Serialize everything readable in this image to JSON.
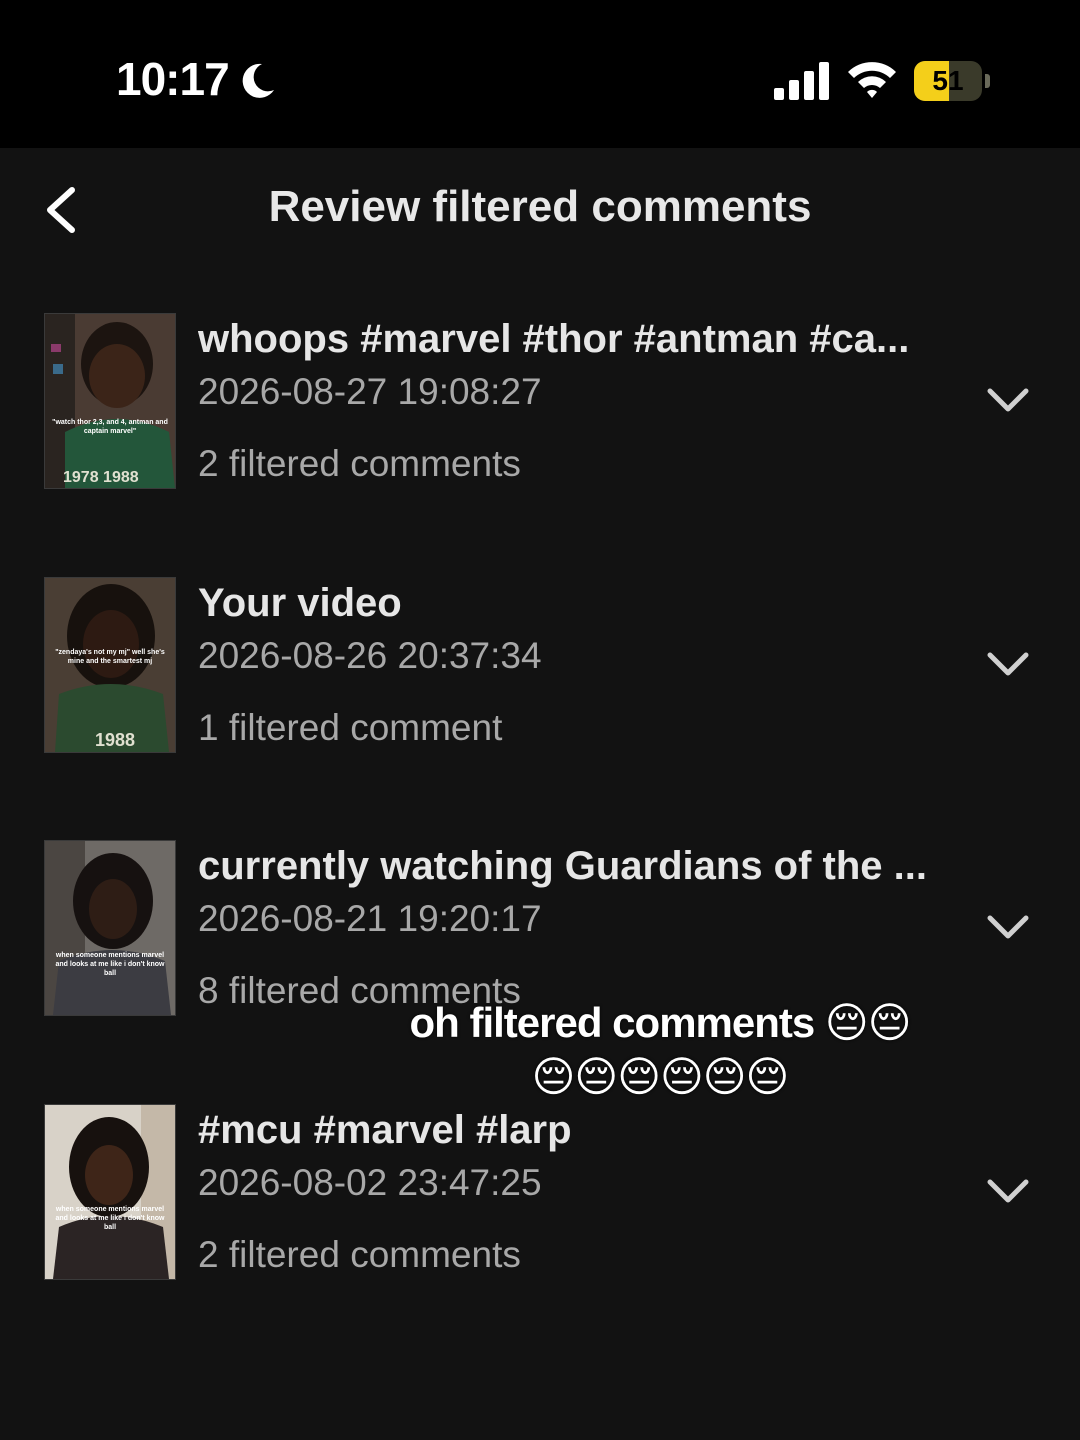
{
  "status_bar": {
    "time": "10:17",
    "battery_level": "51",
    "battery_fraction": 0.51,
    "battery_color": "#f4cf1a"
  },
  "header": {
    "title": "Review filtered comments",
    "back_icon": "chevron-left-icon"
  },
  "items": [
    {
      "title": "whoops #marvel #thor #antman #ca...",
      "date": "2026-08-27 19:08:27",
      "count": "2 filtered comments",
      "thumb_caption": "\"watch thor 2,3, and 4, antman and captain marvel\""
    },
    {
      "title": "Your video",
      "date": "2026-08-26 20:37:34",
      "count": "1 filtered comment",
      "thumb_caption": "\"zendaya's not my mj\" well she's mine and the smartest mj"
    },
    {
      "title": "currently watching Guardians of the ...",
      "date": "2026-08-21 19:20:17",
      "count": "8 filtered comments",
      "thumb_caption": "when someone mentions marvel and looks at me like i don't know ball"
    },
    {
      "title": "#mcu #marvel #larp",
      "date": "2026-08-02 23:47:25",
      "count": "2 filtered comments",
      "thumb_caption": "when someone mentions marvel and looks at me like i don't know ball"
    }
  ],
  "overlay": {
    "line1": "oh filtered comments 😔😔",
    "line2": "😔😔😔😔😔😔"
  }
}
